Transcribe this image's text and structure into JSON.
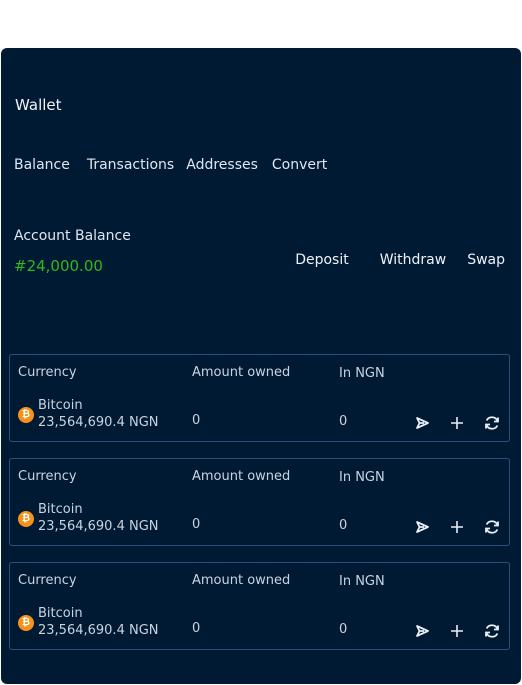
{
  "wallet": {
    "title": "Wallet",
    "tabs": [
      "Balance",
      "Transactions",
      "Addresses",
      "Convert"
    ],
    "account_balance_label": "Account Balance",
    "account_balance_value": "#24,000.00",
    "actions": {
      "deposit": "Deposit",
      "withdraw": "Withdraw",
      "swap": "Swap"
    },
    "accent_color": "#31b81f",
    "coin_color": "#f5921b"
  },
  "currency_cards": [
    {
      "headers": {
        "currency": "Currency",
        "amount": "Amount owned",
        "in_ngn": "In NGN"
      },
      "coin_symbol": "₿",
      "coin_name": "Bitcoin",
      "rate": "23,564,690.4 NGN",
      "amount_owned": "0",
      "value_ngn": "0",
      "icons": [
        "send-icon",
        "plus-icon",
        "refresh-icon"
      ]
    },
    {
      "headers": {
        "currency": "Currency",
        "amount": "Amount owned",
        "in_ngn": "In NGN"
      },
      "coin_symbol": "₿",
      "coin_name": "Bitcoin",
      "rate": "23,564,690.4 NGN",
      "amount_owned": "0",
      "value_ngn": "0",
      "icons": [
        "send-icon",
        "plus-icon",
        "refresh-icon"
      ]
    },
    {
      "headers": {
        "currency": "Currency",
        "amount": "Amount owned",
        "in_ngn": "In NGN"
      },
      "coin_symbol": "₿",
      "coin_name": "Bitcoin",
      "rate": "23,564,690.4 NGN",
      "amount_owned": "0",
      "value_ngn": "0",
      "icons": [
        "send-icon",
        "plus-icon",
        "refresh-icon"
      ]
    }
  ]
}
